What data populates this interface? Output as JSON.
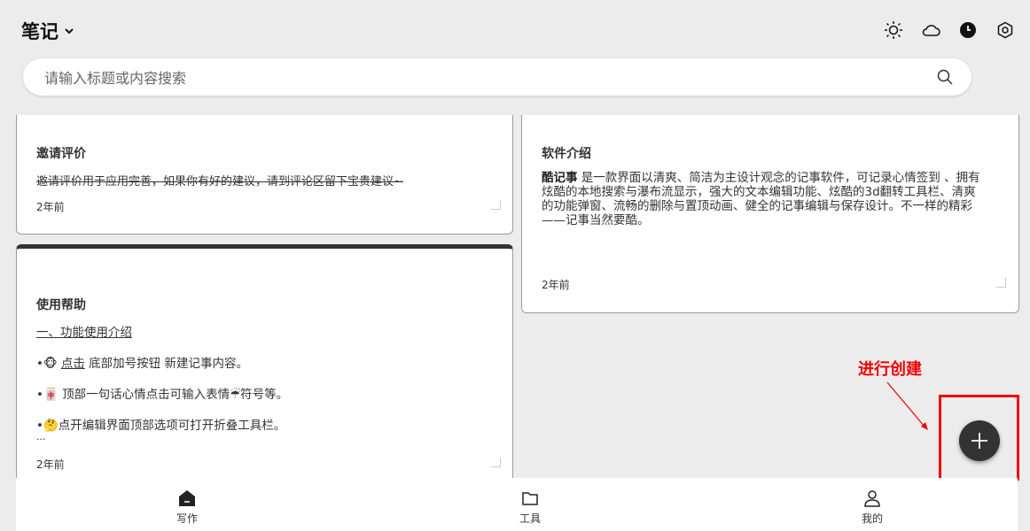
{
  "header": {
    "title": "笔记",
    "chevron": "chevron-down-icon"
  },
  "toolbar_icons": [
    "sun-icon",
    "cloud-icon",
    "clock-icon",
    "settings-icon"
  ],
  "search": {
    "placeholder": "请输入标题或内容搜索",
    "value": ""
  },
  "cards": {
    "invite": {
      "title": "邀请评价",
      "body": "邀请评价用于应用完善，如果你有好的建议，请到评论区留下宝贵建议~",
      "time": "2年前"
    },
    "help": {
      "title": "使用帮助",
      "section": "一、功能使用介绍",
      "line1_pre": "•🐵 ",
      "line1_link": "点击",
      "line1_post": " 底部加号按钮 新建记事内容。",
      "line2": "•🀄 顶部一句话心情点击可输入表情☔符号等。",
      "line3": "•🤔点开编辑界面顶部选项可打开折叠工具栏。",
      "ellipsis": "...",
      "time": "2年前"
    },
    "about": {
      "title": "软件介绍",
      "body_bold": "酷记事",
      "body": " 是一款界面以清爽、简洁为主设计观念的记事软件，可记录心情签到 、拥有炫酷的本地搜索与瀑布流显示，强大的文本编辑功能、炫酷的3d翻转工具栏、清爽的功能弹窗、流畅的删除与置顶动画、健全的记事编辑与保存设计。不一样的精彩 ——记事当然要酷。",
      "time": "2年前"
    }
  },
  "annotation": {
    "text": "进行创建",
    "color": "#ee0000"
  },
  "fab": {
    "icon": "plus-icon"
  },
  "bottom_nav": [
    {
      "label": "写作",
      "icon": "home-icon"
    },
    {
      "label": "工具",
      "icon": "folder-icon"
    },
    {
      "label": "我的",
      "icon": "user-icon"
    }
  ],
  "colors": {
    "background": "#ececec",
    "card_border": "#9a9a9a",
    "fab": "#333333",
    "accent_red": "#ee0000"
  }
}
